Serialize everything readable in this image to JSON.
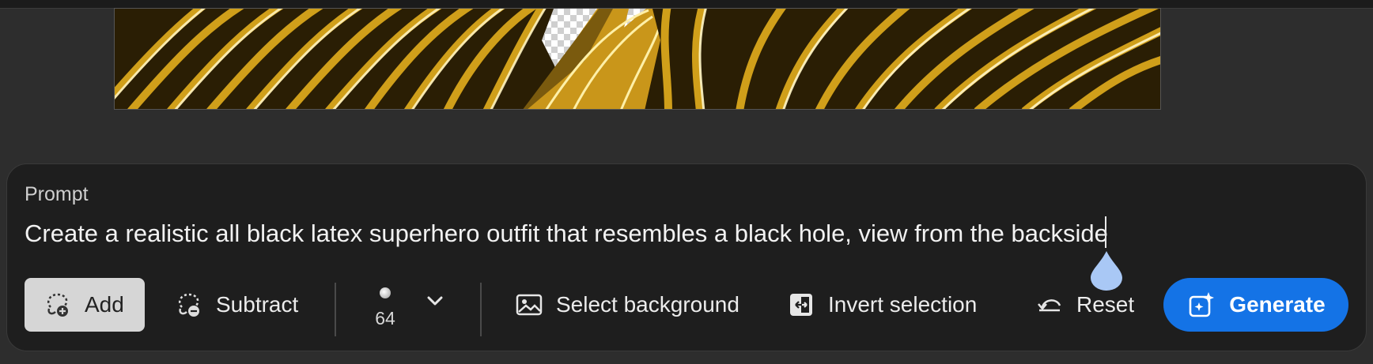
{
  "canvas": {
    "colors": {
      "gold": "#d4a21a",
      "highlight": "#fff6c8",
      "dark": "#2a1e04"
    }
  },
  "panel": {
    "label": "Prompt",
    "prompt_text": "Create a realistic all black latex superhero outfit that resembles a black hole, view from the backside"
  },
  "toolbar": {
    "add_label": "Add",
    "subtract_label": "Subtract",
    "brush_size": "64",
    "select_background_label": "Select background",
    "invert_selection_label": "Invert selection",
    "reset_label": "Reset",
    "generate_label": "Generate",
    "active_mode": "Add"
  },
  "colors": {
    "accent": "#1473e6",
    "panel_bg": "#1e1e1e",
    "app_bg": "#2d2d2d",
    "active_button_bg": "#d6d6d6",
    "handle": "#a9c8f5"
  },
  "icons": {
    "add": "lasso-plus-icon",
    "subtract": "lasso-minus-icon",
    "brush": "brush-dot-icon",
    "chevron": "chevron-down-icon",
    "select_background": "image-icon",
    "invert": "invert-selection-icon",
    "reset": "undo-icon",
    "generate": "sparkle-icon"
  }
}
